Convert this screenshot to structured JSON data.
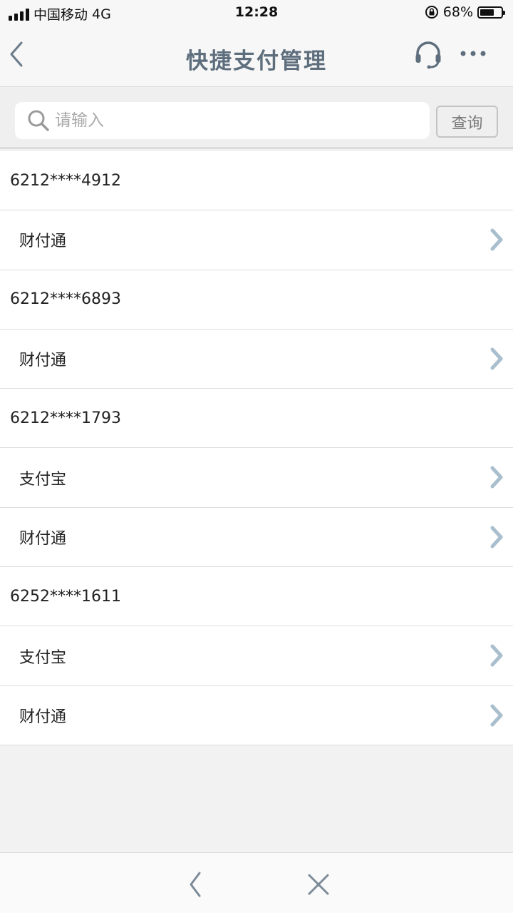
{
  "status_bar": {
    "carrier": "中国移动",
    "network": "4G",
    "time": "12:28",
    "battery_percent_text": "68%",
    "battery_level": 0.68
  },
  "nav": {
    "title": "快捷支付管理",
    "back_icon": "chevron-left-icon",
    "service_icon": "headset-icon",
    "more_icon": "ellipsis-icon"
  },
  "search": {
    "placeholder": "请输入",
    "value": "",
    "button_label": "查询"
  },
  "cards": [
    {
      "number": "6212****4912",
      "channels": [
        "财付通"
      ]
    },
    {
      "number": "6212****6893",
      "channels": [
        "财付通"
      ]
    },
    {
      "number": "6212****1793",
      "channels": [
        "支付宝",
        "财付通"
      ]
    },
    {
      "number": "6252****1611",
      "channels": [
        "支付宝",
        "财付通"
      ]
    }
  ],
  "bottom_bar": {
    "back_icon": "chevron-left-icon",
    "close_icon": "close-icon"
  },
  "colors": {
    "title": "#5e6e7d",
    "chevron": "#a9bfcd",
    "background": "#f2f2f2"
  }
}
